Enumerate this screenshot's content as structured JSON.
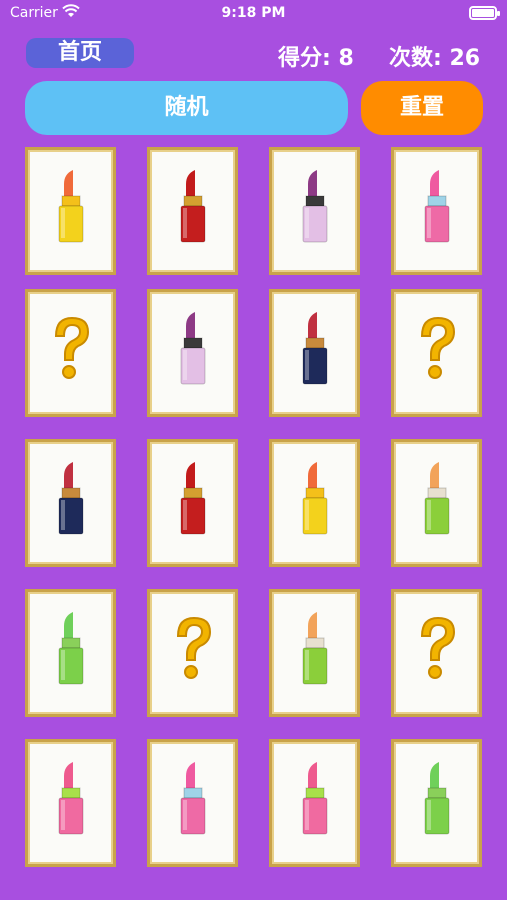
{
  "status": {
    "carrier": "Carrier",
    "time": "9:18 PM"
  },
  "header": {
    "home_label": "首页",
    "score_text": "得分: 8",
    "count_text": "次数: 26"
  },
  "actions": {
    "random_label": "随机",
    "reset_label": "重置"
  },
  "colors": {
    "background": "#a84fe0",
    "home": "#5b63d8",
    "random": "#5ec1f5",
    "reset": "#ff8c00",
    "card_border": "#c9a34a"
  },
  "cards": [
    {
      "state": "face-up",
      "icon": "lipstick-orange-yellow-icon"
    },
    {
      "state": "face-up",
      "icon": "lipstick-red-icon"
    },
    {
      "state": "face-up",
      "icon": "lipstick-purple-icon"
    },
    {
      "state": "face-up",
      "icon": "lipstick-pink-icon"
    },
    {
      "state": "face-down",
      "icon": "question-mark-icon"
    },
    {
      "state": "face-up",
      "icon": "lipstick-purple-icon"
    },
    {
      "state": "face-up",
      "icon": "lipstick-navy-icon"
    },
    {
      "state": "face-down",
      "icon": "question-mark-icon"
    },
    {
      "state": "face-up",
      "icon": "lipstick-navy-icon"
    },
    {
      "state": "face-up",
      "icon": "lipstick-red-icon"
    },
    {
      "state": "face-up",
      "icon": "lipstick-orange-yellow-icon"
    },
    {
      "state": "face-up",
      "icon": "lipstick-peach-green-icon"
    },
    {
      "state": "face-up",
      "icon": "lipstick-green-icon"
    },
    {
      "state": "face-down",
      "icon": "question-mark-icon"
    },
    {
      "state": "face-up",
      "icon": "lipstick-peach-green-icon"
    },
    {
      "state": "face-down",
      "icon": "question-mark-icon"
    },
    {
      "state": "face-up",
      "icon": "lipstick-pink-green-icon"
    },
    {
      "state": "face-up",
      "icon": "lipstick-pink-icon"
    },
    {
      "state": "face-up",
      "icon": "lipstick-pink-green-icon"
    },
    {
      "state": "face-up",
      "icon": "lipstick-green-icon"
    }
  ]
}
